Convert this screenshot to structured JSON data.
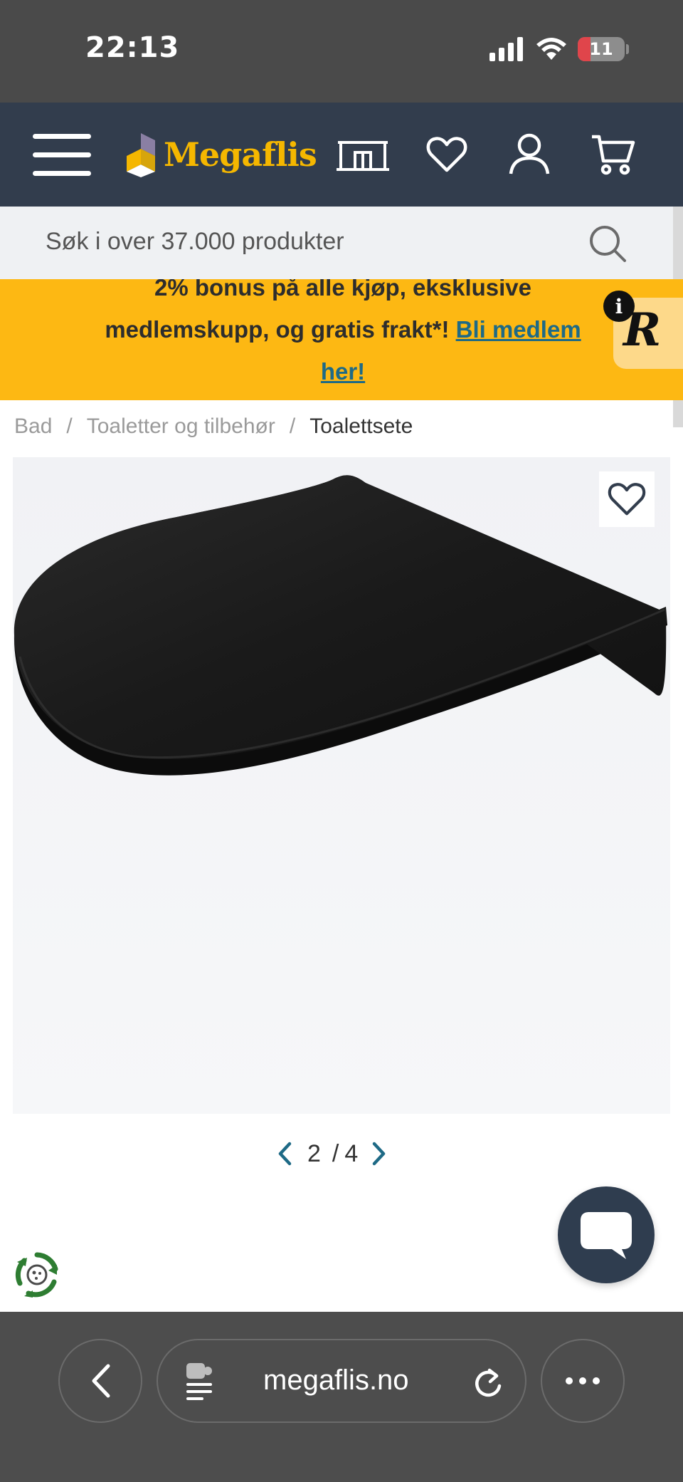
{
  "status_bar": {
    "time": "22:13",
    "battery_level": "11",
    "battery_fraction": 0.11
  },
  "header": {
    "logo_text": "Megaflis",
    "brand_color": "#f5b700",
    "background_color": "#323d4d",
    "icons": [
      "menu-icon",
      "showroom-icon",
      "heart-icon",
      "user-icon",
      "cart-icon"
    ]
  },
  "search": {
    "placeholder": "Søk i over 37.000 produkter"
  },
  "promo": {
    "text_line1": "2% bonus på alle kjøp, eksklusive",
    "text_line2": "medlemskupp, og gratis frakt*! ",
    "link_text_part1": "Bli medlem",
    "link_text_part2": "her!",
    "background_color": "#fdb813",
    "badge_letter": "R",
    "info_label": "i"
  },
  "breadcrumb": {
    "items": [
      "Bad",
      "Toaletter og tilbehør"
    ],
    "current": "Toalettsete",
    "separator": "/"
  },
  "gallery": {
    "current_page": "2",
    "separator": "/",
    "total_pages": "4"
  },
  "browser": {
    "url": "megaflis.no"
  }
}
